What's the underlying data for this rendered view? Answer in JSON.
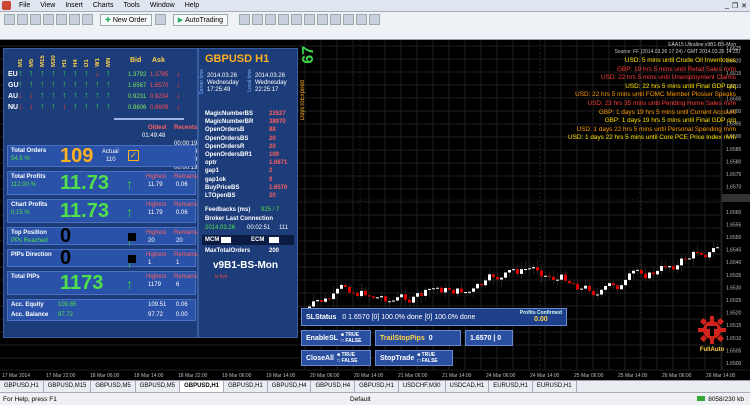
{
  "menubar": [
    "File",
    "View",
    "Insert",
    "Charts",
    "Tools",
    "Window",
    "Help"
  ],
  "toolbar": {
    "new_order": "New Order",
    "autotrading": "AutoTrading"
  },
  "panel": {
    "cols": [
      "M1",
      "M5",
      "M15",
      "M30",
      "H1",
      "H4",
      "D1",
      "W1",
      "MN"
    ],
    "bid_label": "Bid",
    "ask_label": "Ask",
    "rows": [
      {
        "pair": "EU",
        "bid": "1.3792",
        "ask": "1.3795",
        "arrows": [
          "up",
          "up",
          "up",
          "up",
          "up",
          "up",
          "up",
          "down",
          "up"
        ]
      },
      {
        "pair": "GU",
        "bid": "1.6567",
        "ask": "1.6570",
        "arrows": [
          "up",
          "up",
          "up",
          "up",
          "up",
          "up",
          "up",
          "up",
          "up"
        ]
      },
      {
        "pair": "AU",
        "bid": "0.9231",
        "ask": "0.9234",
        "arrows": [
          "down",
          "down",
          "up",
          "up",
          "up",
          "up",
          "up",
          "up",
          "up"
        ]
      },
      {
        "pair": "NU",
        "bid": "0.8606",
        "ask": "0.8609",
        "arrows": [
          "down",
          "down",
          "up",
          "up",
          "down",
          "up",
          "up",
          "up",
          "up"
        ]
      }
    ],
    "oldest": "Oldest",
    "recents": "Recents",
    "times": [
      "01:49:48",
      "00:00:19",
      "00:05:24",
      "00:01:19",
      "00:00:19"
    ],
    "total_orders": {
      "title": "Total Orders",
      "sub": "54.5 %",
      "value": "109",
      "actual_label": "Actual",
      "actual": "110"
    },
    "total_profits": {
      "title": "Total Profits",
      "sub": "112.00 %",
      "value": "11.73",
      "h_label": "Highest",
      "r_label": "Remains",
      "highest": "11.79",
      "remains": "0.06"
    },
    "chart_profits": {
      "title": "Chart Profits",
      "sub": "0.15 %",
      "value": "11.73",
      "h_label": "Highest",
      "r_label": "Remains",
      "highest": "11.79",
      "remains": "0.06"
    },
    "top_position": {
      "title": "Top Position",
      "sub": "PPs Reached",
      "value": "0",
      "h_label": "Highest",
      "r_label": "Remains",
      "highest": "20",
      "remains": "20"
    },
    "pips_direction": {
      "title": "PIPs Direction",
      "value": "0",
      "h_label": "Highest",
      "r_label": "Remains",
      "highest": "1",
      "remains": "1"
    },
    "total_pips": {
      "title": "Total PIPs",
      "value": "1173",
      "h_label": "Highest",
      "r_label": "Remains",
      "highest": "1179",
      "remains": "6"
    },
    "acc_equity": {
      "label": "Acc. Equity",
      "value": "109.85",
      "v1": "109.51",
      "v2": "0.06"
    },
    "acc_balance": {
      "label": "Acc. Balance",
      "value": "97.72",
      "v1": "97.72",
      "v2": "0.00"
    }
  },
  "mid": {
    "symbol": "GBPUSD",
    "tf": "H1",
    "days": "67",
    "days_label": "DaysToExpired",
    "server_label": "Server time",
    "local_label": "Local time",
    "server_date": "2014.03.26",
    "server_day": "Wednesday",
    "server_time": "17:25:49",
    "local_date": "2014.03.26",
    "local_day": "Wednesday",
    "local_time": "22:25:17",
    "fields": [
      {
        "k": "MagicNumberBS",
        "v": "23527"
      },
      {
        "k": "MagicNumberBR",
        "v": "38970"
      },
      {
        "k": "OpenOrdersB",
        "v": "88"
      },
      {
        "k": "OpenOrdersBS",
        "v": "20"
      },
      {
        "k": "OpenOrdersR",
        "v": "20"
      },
      {
        "k": "OpenOrdersBR1",
        "v": "109"
      },
      {
        "k": "optr",
        "v": "1.6671"
      },
      {
        "k": "gap1",
        "v": "2"
      },
      {
        "k": "gap1ok",
        "v": "0"
      },
      {
        "k": "BuyPriceBS",
        "v": "1.6570"
      },
      {
        "k": "LTOpenBS",
        "v": "20"
      }
    ],
    "feedbacks_label": "Feedbacks (ms)",
    "feedbacks": "925 / 7",
    "broker_label": "Broker Last Connection",
    "broker": "2014.03.26 ",
    "broker_time": "00:02:51",
    "broker_n": "111",
    "mcm": "MCM",
    "ecm": "ECM",
    "maxtotal_label": "MaxTotalOrders",
    "maxtotal": "200",
    "brand": "v9B1-BS-Mon",
    "brand_sub": "is live"
  },
  "news": {
    "header": "EAA15 Ultraline v9B1-BS-Mon",
    "source": "Source: FF (2014.03.26 17:24) / GMT 2014.03.26 14:25)",
    "lines": [
      {
        "t": "USD: 5 mins until Crude Oil Inventories",
        "c": "#ffe000"
      },
      {
        "t": "GBP: 19 hrs 5 mins until Retail Sales m/m",
        "c": "#ff3a3a"
      },
      {
        "t": "USD: 22 hrs 5 mins until Unemployment Claims",
        "c": "#ff3a3a"
      },
      {
        "t": "USD: 22 hrs 5 mins until Final GDP q/q",
        "c": "#ffe000"
      },
      {
        "t": "USD: 22 hrs 5 mins until FOMC Member Plosser Speaks",
        "c": "#ff9a00"
      },
      {
        "t": "USD: 23 hrs 35 mins until Pending Home Sales m/m",
        "c": "#ff3a3a"
      },
      {
        "t": "GBP: 1 days 19 hrs 5 mins until Current Account",
        "c": "#ff9a00"
      },
      {
        "t": "GBP: 1 days 19 hrs 5 mins until Final GDP q/q",
        "c": "#ffe000"
      },
      {
        "t": "USD: 1 days 22 hrs 5 mins until Personal Spending m/m",
        "c": "#ff9a00"
      },
      {
        "t": "USD: 1 days 22 hrs 5 mins until Core PCE Price Index m/m",
        "c": "#ffe000"
      }
    ]
  },
  "controls": {
    "slstatus": "SLStatus",
    "status_text": "0  1.6570 [0]  100.0% done  [0]  100.0% done",
    "profits_label": "Profits Confirmed",
    "profits_value": "0.00",
    "enable_sl": "EnableSL",
    "true": "TRUE",
    "false": "FALSE",
    "trail": "TrailStopPips",
    "trail_val": "0",
    "price_val": "1.6570 | 0",
    "closeall": "CloseAll",
    "stoptrade": "StopTrade",
    "fullauto": "FullAuto"
  },
  "price_axis": [
    "1.6625",
    "1.6620",
    "1.6615",
    "1.6610",
    "1.6605",
    "1.6600",
    "1.6595",
    "1.6590",
    "1.6585",
    "1.6580",
    "1.6575",
    "1.6570",
    "1.6565",
    "1.6560",
    "1.6555",
    "1.6550",
    "1.6545",
    "1.6540",
    "1.6535",
    "1.6530",
    "1.6525",
    "1.6520",
    "1.6515",
    "1.6510",
    "1.6505",
    "1.6500"
  ],
  "time_axis": [
    "17 Mar 2014",
    "17 Mar 22:00",
    "18 Mar 06:00",
    "18 Mar 14:00",
    "18 Mar 22:00",
    "19 Mar 06:00",
    "19 Mar 14:00",
    "20 Mar 06:00",
    "20 Mar 14:00",
    "21 Mar 06:00",
    "21 Mar 14:00",
    "24 Mar 06:00",
    "24 Mar 14:00",
    "25 Mar 06:00",
    "25 Mar 14:00",
    "26 Mar 06:00",
    "26 Mar 14:00"
  ],
  "tabs": [
    "GBPUSD,H1",
    "GBPUSD,M15",
    "GBPUSD,M5",
    "GBPUSD,M5",
    "GBPUSD,H1",
    "GBPUSD,H1",
    "GBPUSD,H4",
    "GBPUSD,H4",
    "GBPUSD,H1",
    "USDCHF,M30",
    "USDCAD,H1",
    "EURUSD,H1",
    "EURUSD,H1"
  ],
  "active_tab": 4,
  "status": {
    "help": "For Help, press F1",
    "profile": "Default",
    "conn": "8058/230 kb"
  }
}
